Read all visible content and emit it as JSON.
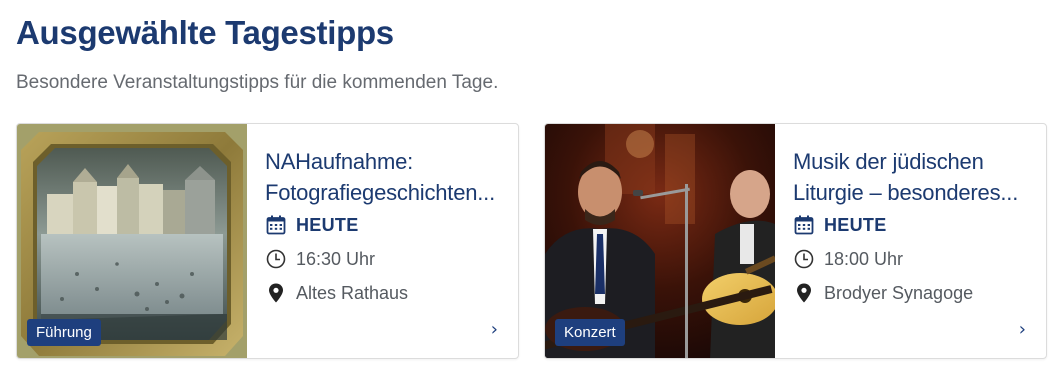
{
  "section": {
    "title": "Ausgewählte Tagestipps",
    "subtitle": "Besondere Veranstaltungstipps für die kommenden Tage."
  },
  "cards": [
    {
      "title": "NAHaufnahme: Fotografiegeschichten...",
      "category": "Führung",
      "date": "HEUTE",
      "time": "16:30 Uhr",
      "location": "Altes Rathaus",
      "more": "›",
      "image_desc": "daguerreotype-town-square"
    },
    {
      "title": "Musik der jüdischen Liturgie – besonderes...",
      "category": "Konzert",
      "date": "HEUTE",
      "time": "18:00 Uhr",
      "location": "Brodyer Synagoge",
      "more": "›",
      "image_desc": "musicians-concert"
    }
  ],
  "colors": {
    "primary": "#1c3a70",
    "badge": "#1e3f7e",
    "muted": "#666a70"
  }
}
